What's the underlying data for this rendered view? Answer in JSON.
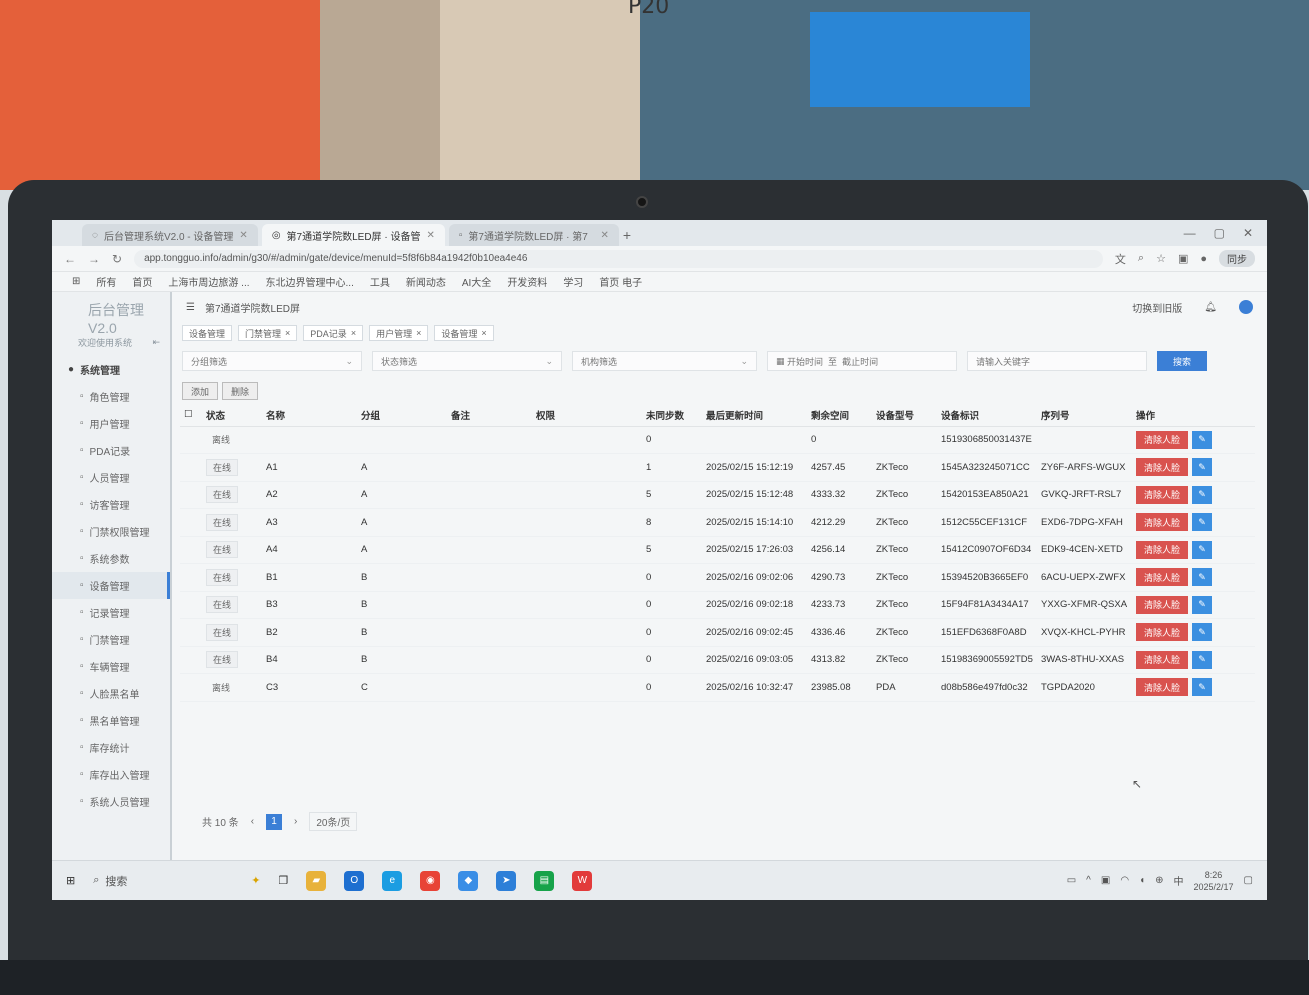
{
  "photo_label": "P20",
  "browser": {
    "tabs": [
      {
        "label": "后台管理系统V2.0 - 设备管理",
        "active": false
      },
      {
        "label": "第7通道学院数LED屏 · 设备管",
        "active": true
      },
      {
        "label": "第7通道学院数LED屏 · 第7",
        "active": false
      }
    ],
    "url": "app.tongguo.info/admin/g30/#/admin/gate/device/menuId=5f8f6b84a1942f0b10ea4e46",
    "sync_label": "同步",
    "bookmarks": [
      "所有",
      "首页",
      "上海市周边旅游 ...",
      "东北边界管理中心...",
      "工具",
      "新闻动态",
      "AI大全",
      "开发资料",
      "学习",
      "首页 电子"
    ]
  },
  "app": {
    "brand": "后台管理V2.0",
    "brand_sub": "欢迎使用系统",
    "menu": [
      {
        "label": "系统管理",
        "group": true,
        "icon": "●"
      },
      {
        "label": "角色管理"
      },
      {
        "label": "用户管理"
      },
      {
        "label": "PDA记录"
      },
      {
        "label": "人员管理"
      },
      {
        "label": "访客管理"
      },
      {
        "label": "门禁权限管理"
      },
      {
        "label": "系统参数"
      },
      {
        "label": "设备管理",
        "active": true
      },
      {
        "label": "记录管理"
      },
      {
        "label": "门禁管理"
      },
      {
        "label": "车辆管理"
      },
      {
        "label": "人脸黑名单"
      },
      {
        "label": "黑名单管理"
      },
      {
        "label": "库存统计"
      },
      {
        "label": "库存出入管理"
      },
      {
        "label": "系统人员管理"
      }
    ],
    "header": {
      "breadcrumb": "第7通道学院数LED屏",
      "switch_label": "切换到旧版"
    },
    "nav_tags": [
      "设备管理",
      "门禁管理",
      "PDA记录",
      "用户管理",
      "设备管理"
    ],
    "filters": {
      "group_placeholder": "分组筛选",
      "status_placeholder": "状态筛选",
      "type_placeholder": "机构筛选",
      "start_label": "开始时间",
      "end_label": "截止时间",
      "keyword_placeholder": "请输入关键字",
      "search_label": "搜索"
    },
    "toolbar": {
      "add_label": "添加",
      "delete_label": "删除"
    },
    "table": {
      "headers": [
        "状态",
        "名称",
        "分组",
        "备注",
        "权限",
        "未同步数",
        "最后更新时间",
        "剩余空间",
        "设备型号",
        "设备标识",
        "序列号",
        "操作"
      ],
      "rows": [
        {
          "status": "离线",
          "name": "",
          "group": "",
          "pending": "0",
          "time": "",
          "space": "0",
          "model": "",
          "id": "1519306850031437E",
          "serial": ""
        },
        {
          "status": "在线",
          "name": "A1",
          "group": "A",
          "pending": "1",
          "time": "2025/02/15 15:12:19",
          "space": "4257.45",
          "model": "ZKTeco",
          "id": "1545A323245071CC",
          "serial": "ZY6F-ARFS-WGUX"
        },
        {
          "status": "在线",
          "name": "A2",
          "group": "A",
          "pending": "5",
          "time": "2025/02/15 15:12:48",
          "space": "4333.32",
          "model": "ZKTeco",
          "id": "15420153EA850A21",
          "serial": "GVKQ-JRFT-RSL7"
        },
        {
          "status": "在线",
          "name": "A3",
          "group": "A",
          "pending": "8",
          "time": "2025/02/15 15:14:10",
          "space": "4212.29",
          "model": "ZKTeco",
          "id": "1512C55CEF131CF",
          "serial": "EXD6-7DPG-XFAH"
        },
        {
          "status": "在线",
          "name": "A4",
          "group": "A",
          "pending": "5",
          "time": "2025/02/15 17:26:03",
          "space": "4256.14",
          "model": "ZKTeco",
          "id": "15412C0907OF6D34",
          "serial": "EDK9-4CEN-XETD"
        },
        {
          "status": "在线",
          "name": "B1",
          "group": "B",
          "pending": "0",
          "time": "2025/02/16 09:02:06",
          "space": "4290.73",
          "model": "ZKTeco",
          "id": "15394520B3665EF0",
          "serial": "6ACU-UEPX-ZWFX"
        },
        {
          "status": "在线",
          "name": "B3",
          "group": "B",
          "pending": "0",
          "time": "2025/02/16 09:02:18",
          "space": "4233.73",
          "model": "ZKTeco",
          "id": "15F94F81A3434A17",
          "serial": "YXXG-XFMR-QSXA"
        },
        {
          "status": "在线",
          "name": "B2",
          "group": "B",
          "pending": "0",
          "time": "2025/02/16 09:02:45",
          "space": "4336.46",
          "model": "ZKTeco",
          "id": "151EFD6368F0A8D",
          "serial": "XVQX-KHCL-PYHR"
        },
        {
          "status": "在线",
          "name": "B4",
          "group": "B",
          "pending": "0",
          "time": "2025/02/16 09:03:05",
          "space": "4313.82",
          "model": "ZKTeco",
          "id": "15198369005592TD5",
          "serial": "3WAS-8THU-XXAS"
        },
        {
          "status": "离线",
          "name": "C3",
          "group": "C",
          "pending": "0",
          "time": "2025/02/16 10:32:47",
          "space": "23985.08",
          "model": "PDA",
          "id": "d08b586e497fd0c32",
          "serial": "TGPDA2020"
        }
      ],
      "op_clear_label": "清除人脸",
      "op_edit_label": "✎"
    },
    "pager": {
      "total": "共 10 条",
      "current": "1",
      "size": "20条/页"
    }
  },
  "taskbar": {
    "search_label": "搜索",
    "time": "8:26",
    "date": "2025/2/17",
    "lang": "中"
  }
}
